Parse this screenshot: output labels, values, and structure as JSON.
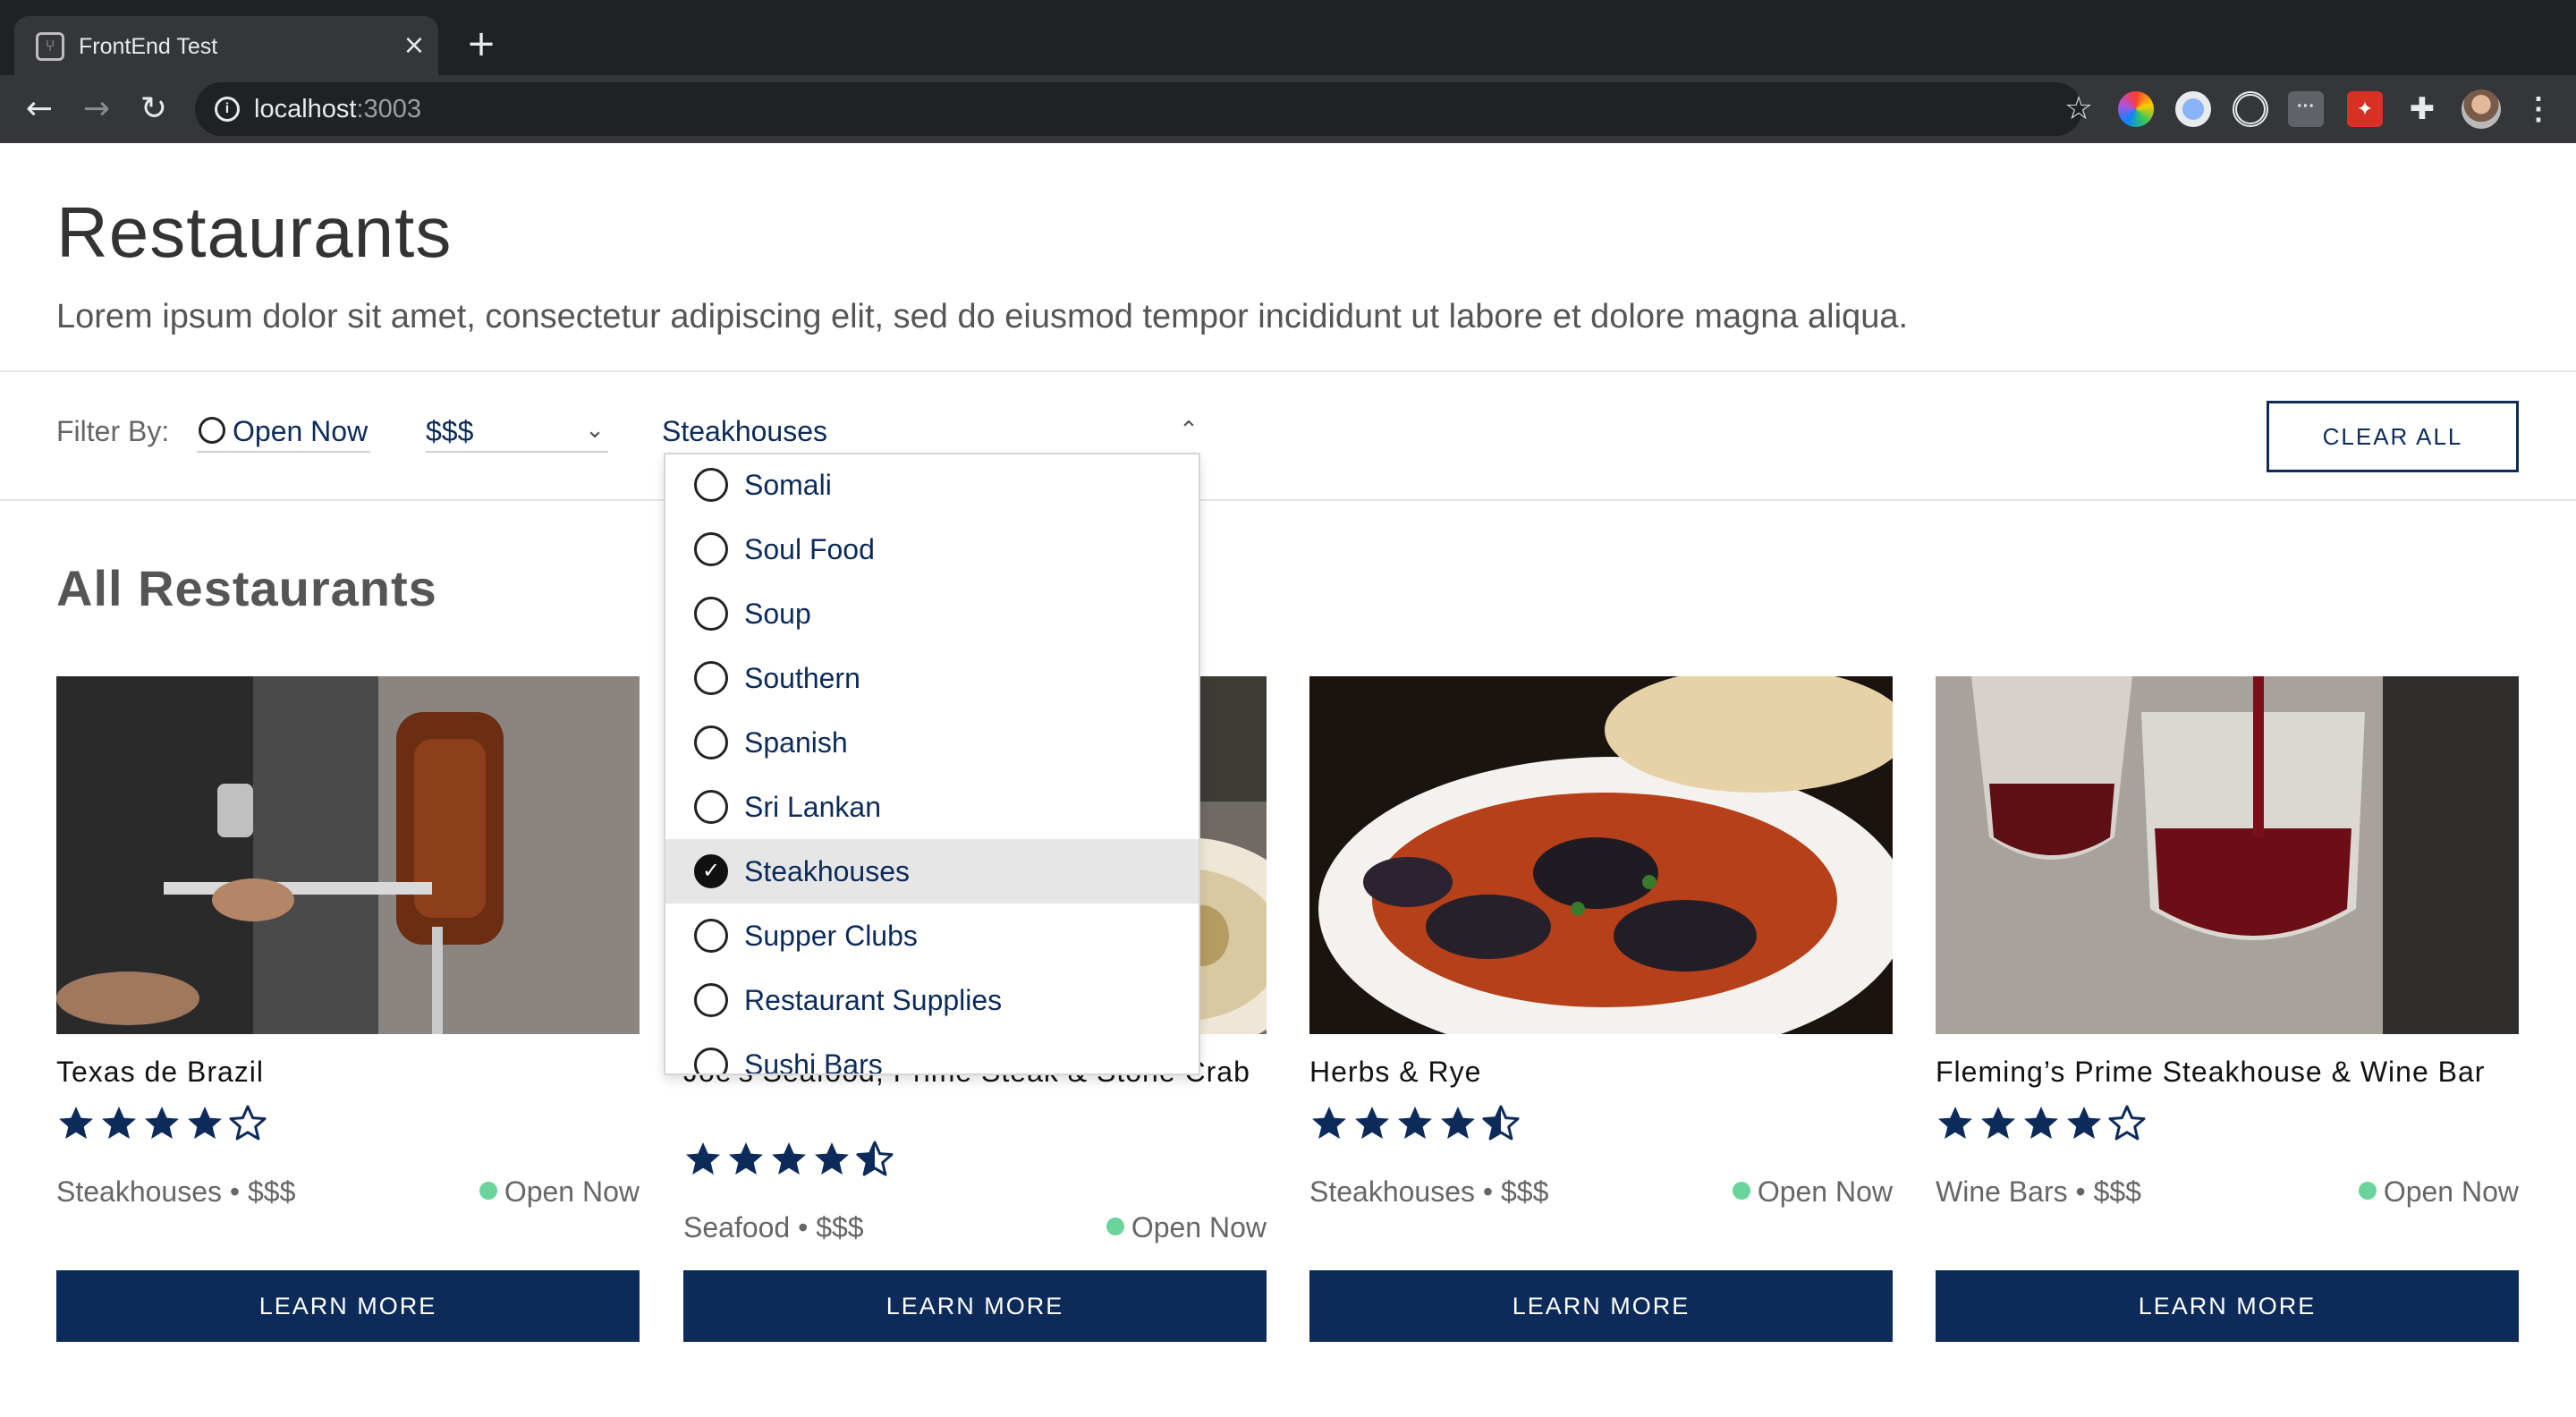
{
  "browser": {
    "tab_title": "FrontEnd Test",
    "url_host": "localhost",
    "url_port": ":3003"
  },
  "header": {
    "title": "Restaurants",
    "description": "Lorem ipsum dolor sit amet, consectetur adipiscing elit, sed do eiusmod tempor incididunt ut labore et dolore magna aliqua."
  },
  "filters": {
    "label": "Filter By:",
    "open_now": "Open Now",
    "price": "$$$",
    "category": "Steakhouses",
    "clear_all": "CLEAR ALL"
  },
  "dropdown": {
    "options": [
      {
        "label": "Somali",
        "selected": false
      },
      {
        "label": "Soul Food",
        "selected": false
      },
      {
        "label": "Soup",
        "selected": false
      },
      {
        "label": "Southern",
        "selected": false
      },
      {
        "label": "Spanish",
        "selected": false
      },
      {
        "label": "Sri Lankan",
        "selected": false
      },
      {
        "label": "Steakhouses",
        "selected": true
      },
      {
        "label": "Supper Clubs",
        "selected": false
      },
      {
        "label": "Restaurant Supplies",
        "selected": false
      },
      {
        "label": "Sushi Bars",
        "selected": false
      }
    ]
  },
  "section": {
    "title": "All Restaurants"
  },
  "restaurants": [
    {
      "name": "Texas de Brazil",
      "rating": 4,
      "category": "Steakhouses",
      "price": "$$$",
      "status": "Open Now",
      "button": "LEARN MORE"
    },
    {
      "name": "Joe's Seafood, Prime Steak & Stone Crab",
      "rating": 4.5,
      "category": "Seafood",
      "price": "$$$",
      "status": "Open Now",
      "button": "LEARN MORE"
    },
    {
      "name": "Herbs & Rye",
      "rating": 4.5,
      "category": "Steakhouses",
      "price": "$$$",
      "status": "Open Now",
      "button": "LEARN MORE"
    },
    {
      "name": "Fleming’s Prime Steakhouse & Wine Bar",
      "rating": 4,
      "category": "Wine Bars",
      "price": "$$$",
      "status": "Open Now",
      "button": "LEARN MORE"
    }
  ],
  "colors": {
    "primary": "#0c2b5a",
    "open_dot": "#6ad49b",
    "star": "#0c2b5a"
  },
  "icons": {
    "tab_favicon": "fork-knife-icon",
    "back": "arrow-left-icon",
    "forward": "arrow-right-icon",
    "reload": "reload-icon",
    "info": "info-icon",
    "bookmark": "star-outline-icon",
    "extensions": "puzzle-icon",
    "menu": "kebab-menu-icon"
  }
}
